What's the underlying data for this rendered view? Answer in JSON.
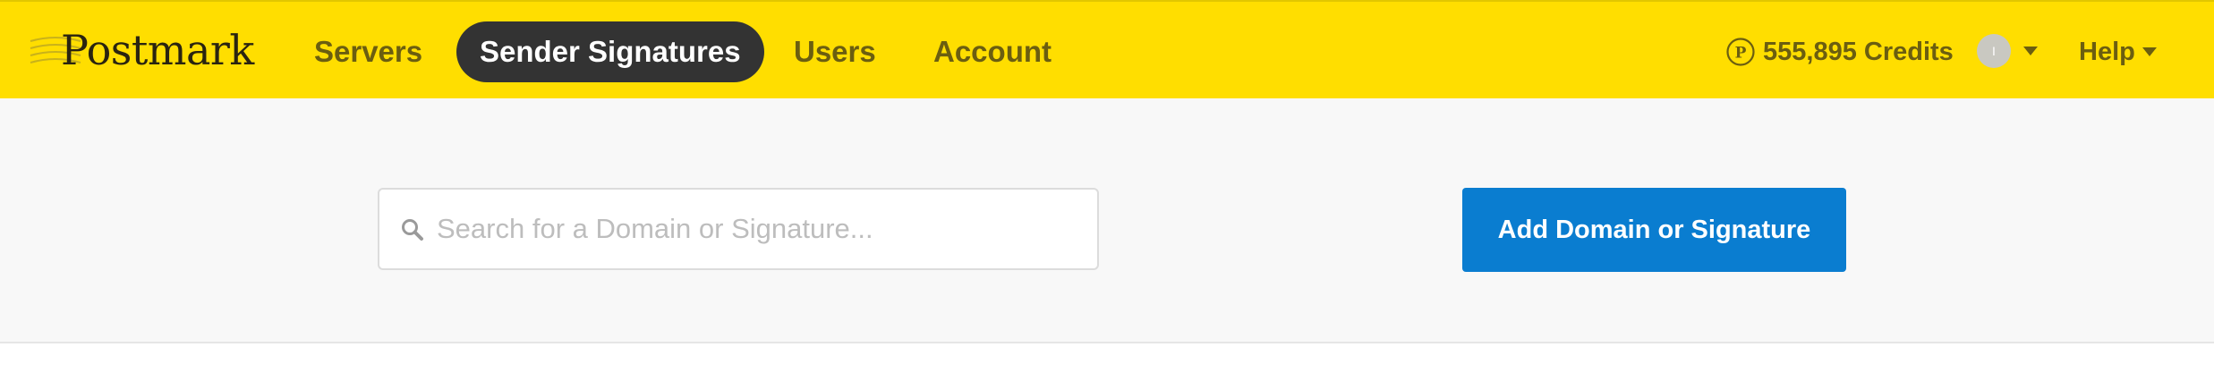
{
  "brand": {
    "logo_text": "Postmark",
    "accent_color": "#ffde00",
    "active_nav_color": "#333333",
    "primary_button_color": "#0a7dd0"
  },
  "nav": {
    "items": [
      {
        "label": "Servers",
        "active": false
      },
      {
        "label": "Sender Signatures",
        "active": true
      },
      {
        "label": "Users",
        "active": false
      },
      {
        "label": "Account",
        "active": false
      }
    ]
  },
  "account": {
    "credits_icon": "credit-coin-icon",
    "credits_label": "555,895 Credits",
    "avatar_initial": "I",
    "help_label": "Help"
  },
  "toolbar": {
    "search_placeholder": "Search for a Domain or Signature...",
    "search_value": "",
    "add_button_label": "Add Domain or Signature"
  }
}
